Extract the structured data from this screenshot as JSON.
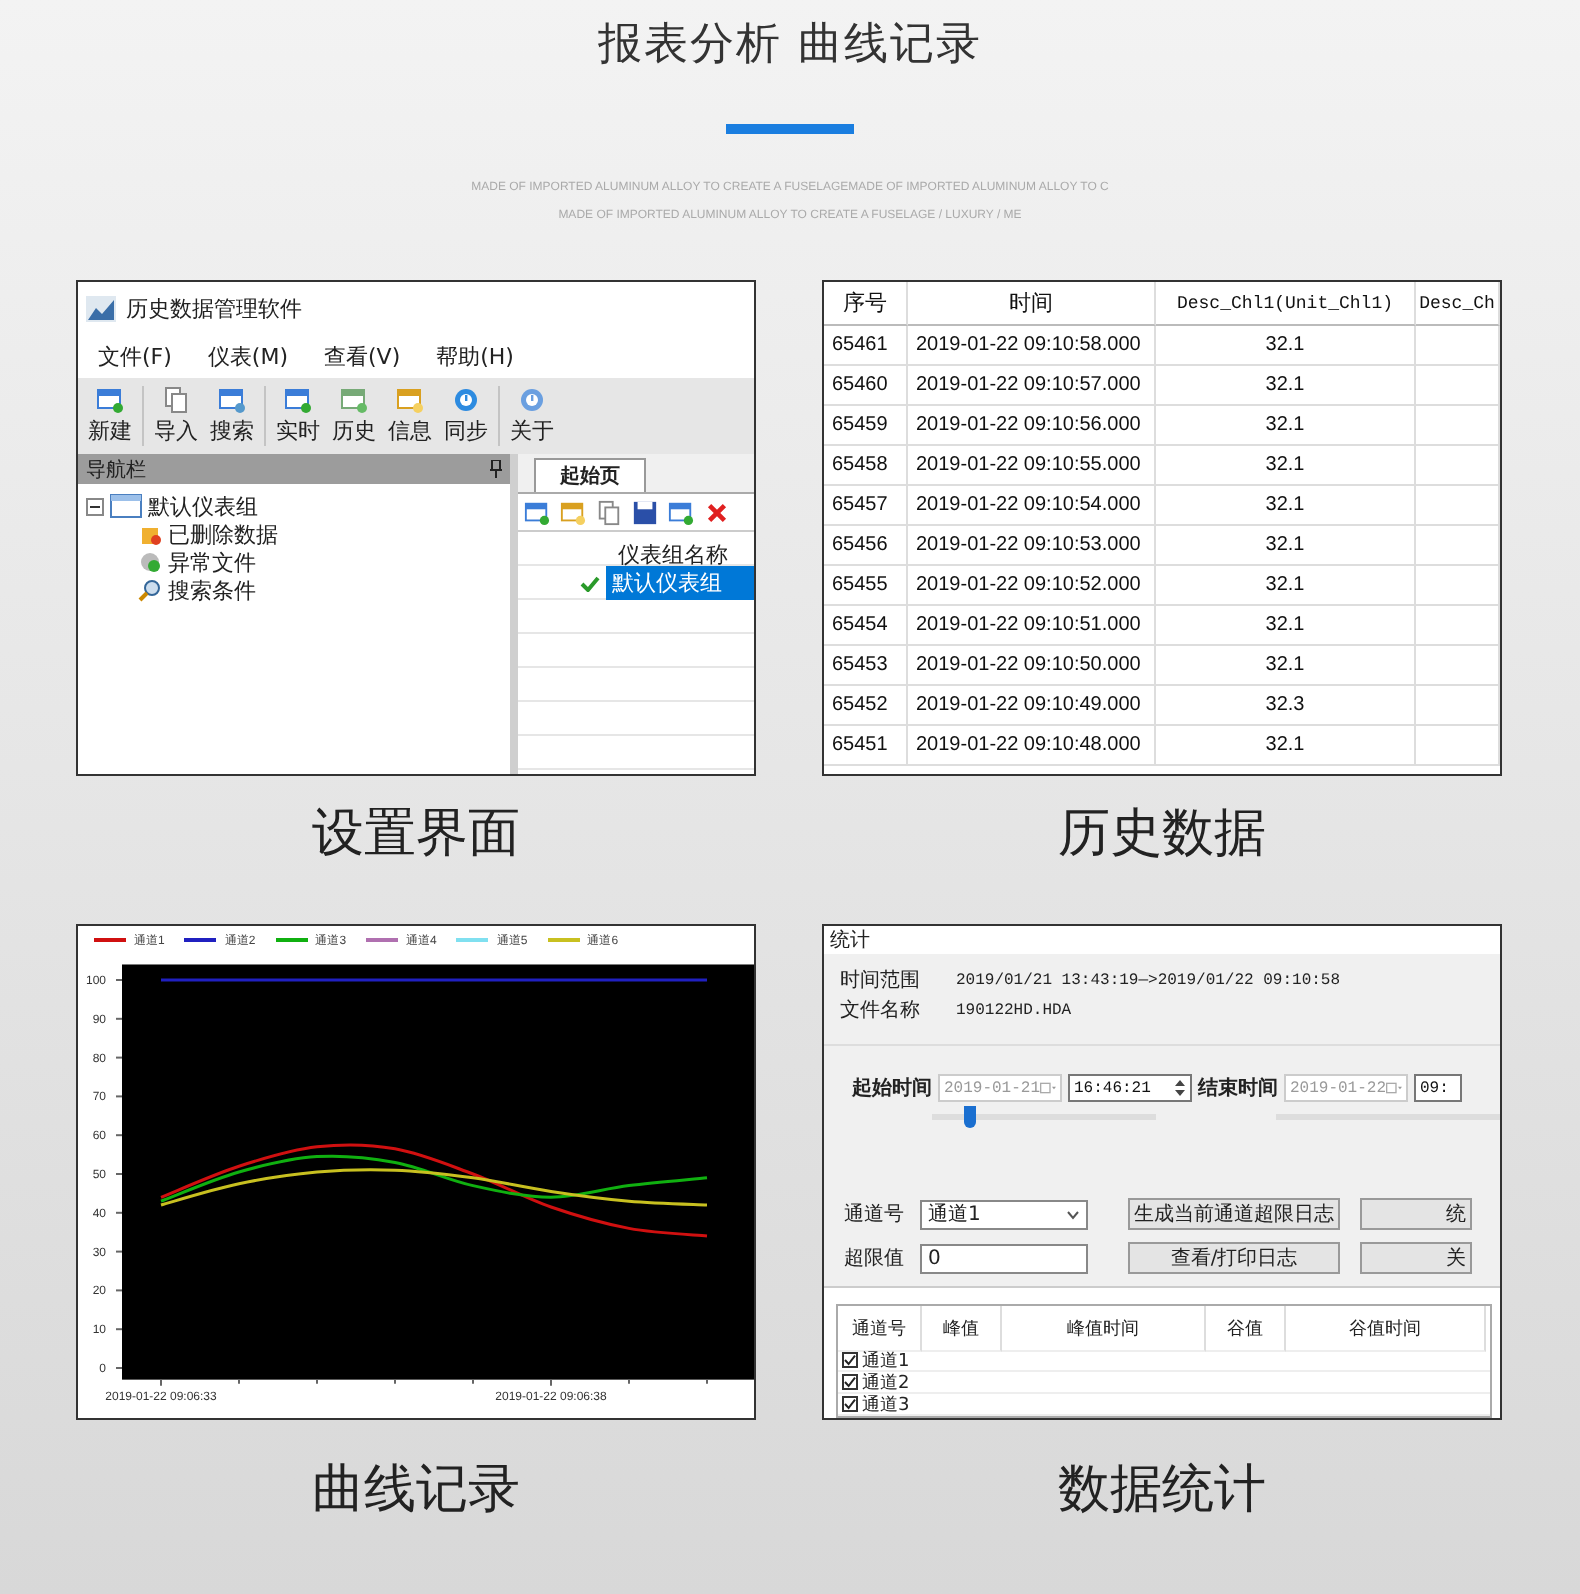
{
  "header": {
    "title": "报表分析 曲线记录",
    "lines": [
      "MADE OF IMPORTED ALUMINUM ALLOY TO CREATE A FUSELAGEMADE OF IMPORTED ALUMINUM ALLOY TO C",
      "MADE OF IMPORTED ALUMINUM ALLOY TO CREATE A FUSELAGE / LUXURY / ME"
    ]
  },
  "panels": [
    {
      "kind": "software",
      "caption": "设置界面",
      "window": {
        "title": "历史数据管理软件",
        "menu": [
          "文件(F)",
          "仪表(M)",
          "查看(V)",
          "帮助(H)"
        ],
        "toolbar_groups": [
          [
            "新建"
          ],
          [
            "导入",
            "搜索"
          ],
          [
            "实时",
            "历史",
            "信息",
            "同步"
          ],
          [
            "关于"
          ]
        ],
        "nav": {
          "title": "导航栏",
          "tree": [
            {
              "label": "默认仪表组",
              "expanded": true,
              "children": [
                {
                  "label": "已删除数据"
                },
                {
                  "label": "异常文件"
                },
                {
                  "label": "搜索条件"
                }
              ]
            }
          ]
        },
        "tabs": [
          {
            "label": "起始页",
            "selected": true
          }
        ],
        "grid": {
          "column": "仪表组名称",
          "rows": [
            {
              "name": "默认仪表组",
              "checked": true,
              "selected": true
            }
          ]
        }
      }
    },
    {
      "kind": "table",
      "caption": "历史数据",
      "columns": [
        "序号",
        "时间",
        "Desc_Chl1(Unit_Chl1)",
        "Desc_Ch"
      ],
      "rows": [
        [
          "65461",
          "2019-01-22 09:10:58.000",
          "32.1"
        ],
        [
          "65460",
          "2019-01-22 09:10:57.000",
          "32.1"
        ],
        [
          "65459",
          "2019-01-22 09:10:56.000",
          "32.1"
        ],
        [
          "65458",
          "2019-01-22 09:10:55.000",
          "32.1"
        ],
        [
          "65457",
          "2019-01-22 09:10:54.000",
          "32.1"
        ],
        [
          "65456",
          "2019-01-22 09:10:53.000",
          "32.1"
        ],
        [
          "65455",
          "2019-01-22 09:10:52.000",
          "32.1"
        ],
        [
          "65454",
          "2019-01-22 09:10:51.000",
          "32.1"
        ],
        [
          "65453",
          "2019-01-22 09:10:50.000",
          "32.1"
        ],
        [
          "65452",
          "2019-01-22 09:10:49.000",
          "32.3"
        ],
        [
          "65451",
          "2019-01-22 09:10:48.000",
          "32.1"
        ]
      ]
    },
    {
      "kind": "chart",
      "caption": "曲线记录",
      "chart_data": {
        "type": "line",
        "legend": "top",
        "categories": [
          "2019-01-22 09:06:33",
          null,
          null,
          null,
          null,
          "2019-01-22 09:06:38",
          null,
          null
        ],
        "ylim": [
          -3,
          104
        ],
        "yticks": [
          0,
          10,
          20,
          30,
          40,
          50,
          60,
          70,
          80,
          90,
          100
        ],
        "series": [
          {
            "name": "通道1",
            "color": "#d01010",
            "values": [
              44,
              52,
              57,
              56.5,
              50,
              41.5,
              36,
              34
            ]
          },
          {
            "name": "通道2",
            "color": "#2020c0",
            "values": [
              100,
              100,
              100,
              100,
              100,
              100,
              100,
              100
            ]
          },
          {
            "name": "通道3",
            "color": "#10b010",
            "values": [
              43,
              50.5,
              54.5,
              53,
              47,
              44,
              47,
              49
            ]
          },
          {
            "name": "通道4",
            "color": "#b070b0",
            "values": [
              null,
              null,
              null,
              null,
              null,
              null,
              null,
              null
            ]
          },
          {
            "name": "通道5",
            "color": "#80e0f0",
            "values": [
              null,
              null,
              null,
              null,
              null,
              null,
              null,
              null
            ]
          },
          {
            "name": "通道6",
            "color": "#c8c020",
            "values": [
              42,
              47.5,
              50.5,
              51,
              49,
              45.5,
              43,
              42
            ]
          }
        ]
      }
    },
    {
      "kind": "stats",
      "caption": "数据统计",
      "title": "统计",
      "info": [
        {
          "label": "时间范围",
          "value": "2019/01/21 13:43:19—>2019/01/22 09:10:58"
        },
        {
          "label": "文件名称",
          "value": "190122HD.HDA"
        }
      ],
      "start": {
        "label": "起始时间",
        "date": "2019-01-21",
        "date_disabled": true,
        "time": "16:46:21",
        "level": 0.17
      },
      "end": {
        "label": "结束时间",
        "date": "2019-01-22",
        "date_disabled": true,
        "time": "09:"
      },
      "channel": {
        "label": "通道号",
        "value": "通道1"
      },
      "limit": {
        "label": "超限值",
        "value": "0"
      },
      "buttons": [
        "生成当前通道超限日志",
        "查看/打印日志"
      ],
      "side_buttons": [
        "统",
        "关"
      ],
      "table": {
        "columns": [
          "通道号",
          "峰值",
          "峰值时间",
          "谷值",
          "谷值时间"
        ],
        "rows": [
          {
            "label": "通道1",
            "checked": true
          },
          {
            "label": "通道2",
            "checked": true
          },
          {
            "label": "通道3",
            "checked": true
          }
        ]
      }
    }
  ]
}
